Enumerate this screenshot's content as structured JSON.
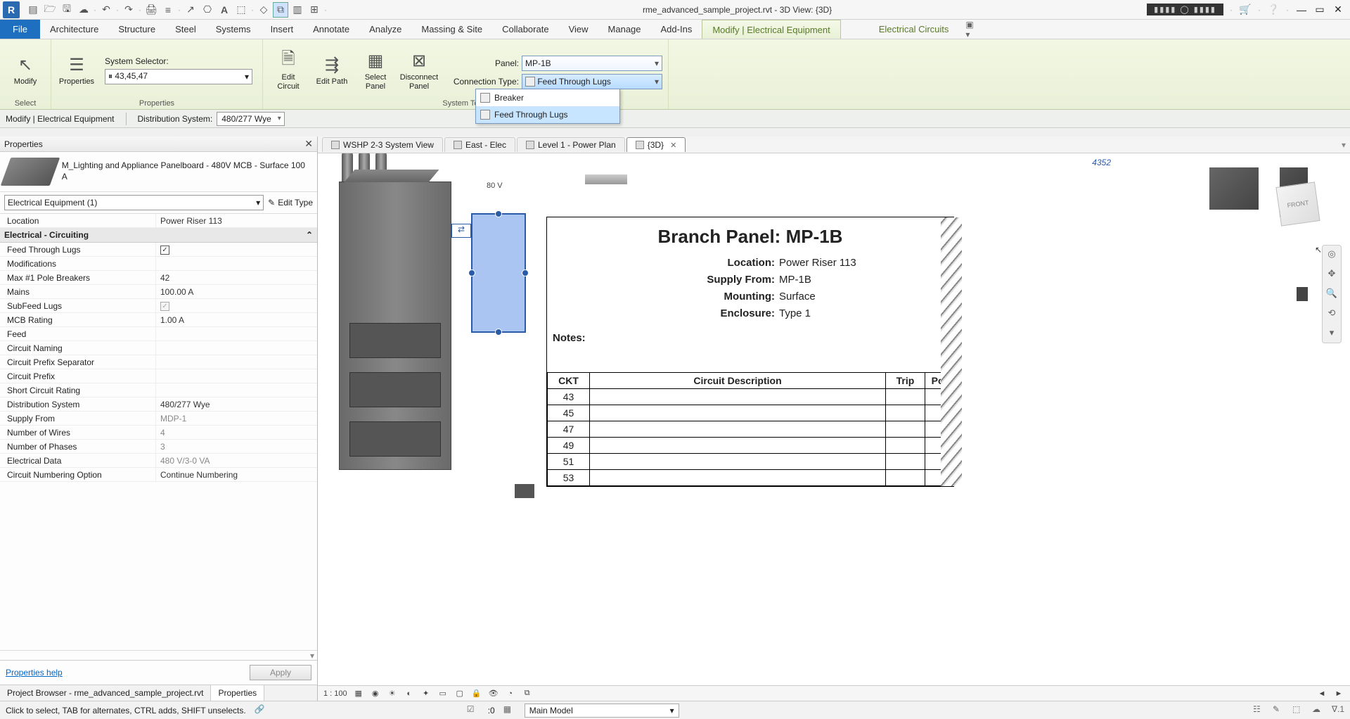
{
  "title": "rme_advanced_sample_project.rvt - 3D View: {3D}",
  "qat_search_box": "",
  "menu": {
    "file": "File",
    "tabs": [
      "Architecture",
      "Structure",
      "Steel",
      "Systems",
      "Insert",
      "Annotate",
      "Analyze",
      "Massing & Site",
      "Collaborate",
      "View",
      "Manage",
      "Add-Ins",
      "Modify | Electrical Equipment",
      "Electrical Circuits"
    ]
  },
  "ribbon": {
    "select_group": "Select",
    "modify": "Modify",
    "props_group": "Properties",
    "properties": "Properties",
    "system_tools": "System Tools",
    "system_selector_label": "System Selector:",
    "system_selector_value": "⏸ 43,45,47",
    "edit_circuit": "Edit Circuit",
    "edit_path": "Edit Path",
    "select_panel": "Select Panel",
    "disconnect_panel": "Disconnect Panel",
    "panel_label": "Panel:",
    "panel_value": "MP-1B",
    "conn_type_label": "Connection Type:",
    "conn_type_value": "Feed Through Lugs",
    "dd_items": [
      "Breaker",
      "Feed Through Lugs"
    ]
  },
  "options_bar": {
    "context": "Modify | Electrical Equipment",
    "dist_label": "Distribution System:",
    "dist_value": "480/277 Wye"
  },
  "properties": {
    "title": "Properties",
    "type_name": "M_Lighting and Appliance Panelboard - 480V MCB - Surface 100 A",
    "instance": "Electrical Equipment (1)",
    "edit_type": "Edit Type",
    "cat": "Electrical - Circuiting",
    "location_row": {
      "k": "Location",
      "v": "Power Riser 113"
    },
    "rows": [
      {
        "k": "Feed Through Lugs",
        "v": "__check__"
      },
      {
        "k": "Modifications",
        "v": ""
      },
      {
        "k": "Max #1 Pole Breakers",
        "v": "42"
      },
      {
        "k": "Mains",
        "v": "100.00 A"
      },
      {
        "k": "SubFeed Lugs",
        "v": "__check_dim__"
      },
      {
        "k": "MCB Rating",
        "v": "1.00 A"
      },
      {
        "k": "Feed",
        "v": ""
      },
      {
        "k": "Circuit Naming",
        "v": ""
      },
      {
        "k": "Circuit Prefix Separator",
        "v": ""
      },
      {
        "k": "Circuit Prefix",
        "v": ""
      },
      {
        "k": "Short Circuit Rating",
        "v": ""
      },
      {
        "k": "Distribution System",
        "v": "480/277 Wye"
      },
      {
        "k": "Supply From",
        "v": "MDP-1",
        "dim": true
      },
      {
        "k": "Number of Wires",
        "v": "4",
        "dim": true
      },
      {
        "k": "Number of Phases",
        "v": "3",
        "dim": true
      },
      {
        "k": "Electrical Data",
        "v": "480 V/3-0 VA",
        "dim": true
      },
      {
        "k": "Circuit Numbering Option",
        "v": "Continue Numbering"
      }
    ],
    "help": "Properties help",
    "apply": "Apply",
    "tabs": [
      "Project Browser - rme_advanced_sample_project.rvt",
      "Properties"
    ]
  },
  "views": {
    "tabs": [
      {
        "label": "WSHP 2-3 System View"
      },
      {
        "label": "East - Elec"
      },
      {
        "label": "Level 1 - Power Plan"
      },
      {
        "label": "{3D}",
        "active": true
      }
    ]
  },
  "schedule": {
    "title": "Branch Panel: MP-1B",
    "info": [
      {
        "k": "Location:",
        "v": "Power Riser 113"
      },
      {
        "k": "Supply From:",
        "v": "MP-1B"
      },
      {
        "k": "Mounting:",
        "v": "Surface"
      },
      {
        "k": "Enclosure:",
        "v": "Type 1"
      }
    ],
    "notes": "Notes:",
    "headers": [
      "CKT",
      "Circuit Description",
      "Trip",
      "Pol"
    ],
    "ckts": [
      "43",
      "45",
      "47",
      "49",
      "51",
      "53"
    ]
  },
  "dim_text": "4352",
  "unit_text": "80 V",
  "navcube": "FRONT",
  "vcb": {
    "scale": "1 : 100"
  },
  "status": {
    "hint": "Click to select, TAB for alternates, CTRL adds, SHIFT unselects.",
    "n": ":0",
    "workset": "Main Model"
  }
}
